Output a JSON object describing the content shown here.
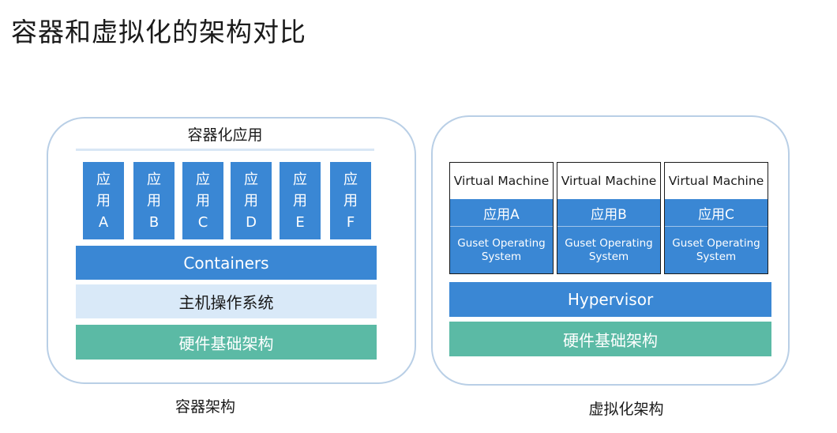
{
  "title": "容器和虚拟化的架构对比",
  "container": {
    "header": "容器化应用",
    "apps": [
      {
        "l1": "应",
        "l2": "用",
        "l3": "A"
      },
      {
        "l1": "应",
        "l2": "用",
        "l3": "B"
      },
      {
        "l1": "应",
        "l2": "用",
        "l3": "C"
      },
      {
        "l1": "应",
        "l2": "用",
        "l3": "D"
      },
      {
        "l1": "应",
        "l2": "用",
        "l3": "E"
      },
      {
        "l1": "应",
        "l2": "用",
        "l3": "F"
      }
    ],
    "containers": "Containers",
    "host_os": "主机操作系统",
    "hardware": "硬件基础架构",
    "caption": "容器架构"
  },
  "virtual": {
    "vms": [
      {
        "title": "Virtual Machine",
        "app": "应用A",
        "os_line1": "Guset Operating",
        "os_line2": "System"
      },
      {
        "title": "Virtual Machine",
        "app": "应用B",
        "os_line1": "Guset Operating",
        "os_line2": "System"
      },
      {
        "title": "Virtual Machine",
        "app": "应用C",
        "os_line1": "Guset Operating",
        "os_line2": "System"
      }
    ],
    "hypervisor": "Hypervisor",
    "hardware": "硬件基础架构",
    "caption": "虚拟化架构"
  },
  "colors": {
    "blue": "#3a87d4",
    "light_blue": "#d9e9f8",
    "green": "#5bbaa5",
    "panel_border": "#b9cfe6"
  }
}
